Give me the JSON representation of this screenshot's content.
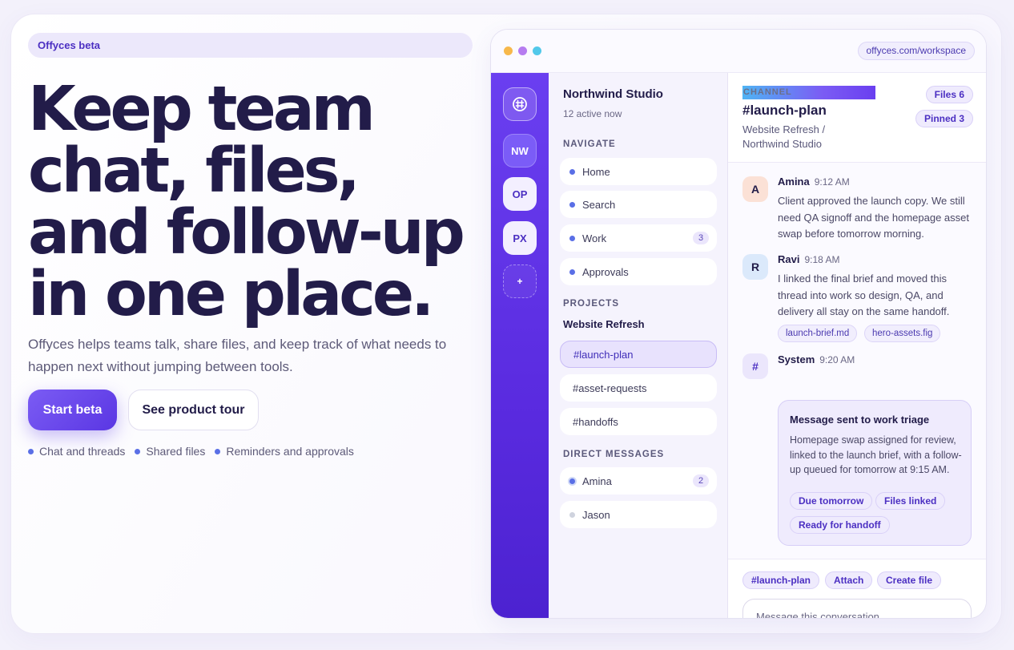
{
  "hero": {
    "beta_label": "Offyces beta",
    "headline": "Keep team chat, files, and follow-up in one place.",
    "lede": "Offyces helps teams talk, share files, and keep track of what needs to happen next without jumping between tools.",
    "primary_cta": "Start beta",
    "secondary_cta": "See product tour",
    "features": [
      "Chat and threads",
      "Shared files",
      "Reminders and approvals"
    ]
  },
  "window": {
    "url": "offyces.com/workspace",
    "traffic_colors": [
      "#f7b84b",
      "#b67cf0",
      "#52c8ea"
    ]
  },
  "rail": {
    "home_icon": "workspace-hash-icon",
    "items": [
      "NW",
      "OP",
      "PX"
    ],
    "add_label": "+"
  },
  "sidebar": {
    "workspace": "Northwind Studio",
    "status": "12 active now",
    "navigate_heading": "NAVIGATE",
    "nav": [
      {
        "label": "Home"
      },
      {
        "label": "Search"
      },
      {
        "label": "Work",
        "badge": "3"
      },
      {
        "label": "Approvals"
      }
    ],
    "projects_heading": "PROJECTS",
    "project_name": "Website Refresh",
    "channels": [
      "#launch-plan",
      "#asset-requests",
      "#handoffs"
    ],
    "dm_heading": "DIRECT MESSAGES",
    "dms": [
      {
        "label": "Amina",
        "badge": "2"
      },
      {
        "label": "Jason"
      }
    ]
  },
  "channel": {
    "label": "CHANNEL",
    "title": "#launch-plan",
    "breadcrumb": "Website Refresh / Northwind Studio",
    "files_pill": "Files 6",
    "pinned_pill": "Pinned 3"
  },
  "messages": [
    {
      "avatar": "A",
      "name": "Amina",
      "time": "9:12 AM",
      "text": "Client approved the launch copy. We still need QA signoff and the homepage asset swap before tomorrow morning."
    },
    {
      "avatar": "R",
      "name": "Ravi",
      "time": "9:18 AM",
      "text": "I linked the final brief and moved this thread into work so design, QA, and delivery all stay on the same handoff.",
      "files": [
        "launch-brief.md",
        "hero-assets.fig"
      ]
    },
    {
      "avatar": "#",
      "name": "System",
      "time": "9:20 AM"
    }
  ],
  "system_card": {
    "title": "Message sent to work triage",
    "body": "Homepage swap assigned for review, linked to the launch brief, with a follow-up queued for tomorrow at 9:15 AM.",
    "pills": [
      "Due tomorrow",
      "Files linked",
      "Ready for handoff"
    ]
  },
  "composer": {
    "chips": [
      "#launch-plan",
      "Attach",
      "Create file"
    ],
    "placeholder": "Message this conversation..."
  },
  "colors": {
    "accent": "#5a36e3",
    "rail": "#6a3ff0",
    "dot": "#5a6fe6",
    "ink": "#221c49"
  }
}
